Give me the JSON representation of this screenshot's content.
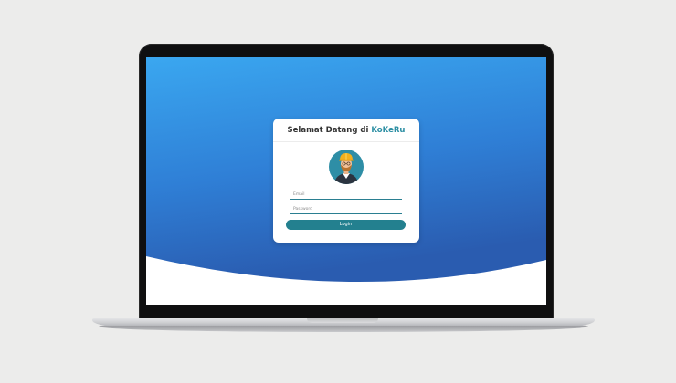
{
  "colors": {
    "page_background": "#ececeb",
    "gradient_top": "#3aa5ee",
    "gradient_bottom": "#2a5fb3",
    "brand": "#2d8fa4",
    "button": "#23808f"
  },
  "login": {
    "title_prefix": "Selamat Datang di",
    "title_brand": "KoKeRu",
    "avatar_icon": "worker-avatar-icon",
    "email_placeholder": "Email",
    "password_placeholder": "Password",
    "button_label": "Login"
  }
}
